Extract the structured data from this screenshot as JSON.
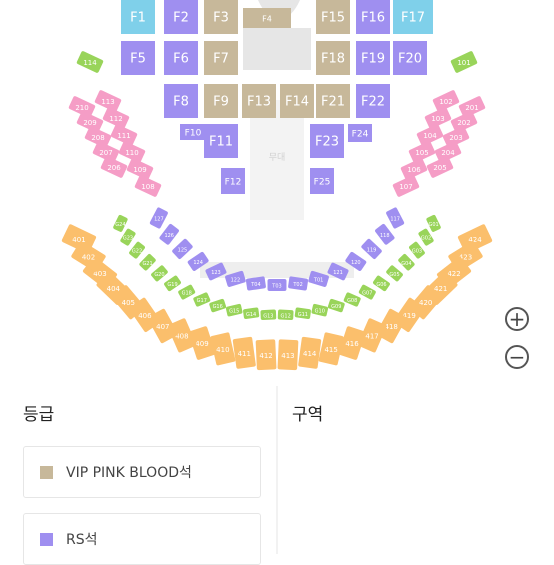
{
  "colors": {
    "vip": "#c7b89a",
    "rs": "#9f8ff0",
    "floor_teal": "#7fd0ea",
    "pink": "#f59dc6",
    "green": "#99d45a",
    "orange": "#fbbf6c",
    "stage": "#e6e6e6"
  },
  "stage_labels": {
    "stage_text": "",
    "center_text": "무대"
  },
  "floor_sections": [
    {
      "label": "F1",
      "grade": "teal"
    },
    {
      "label": "F2",
      "grade": "rs"
    },
    {
      "label": "F3",
      "grade": "vip"
    },
    {
      "label": "F4",
      "grade": "vip"
    },
    {
      "label": "F15",
      "grade": "vip"
    },
    {
      "label": "F16",
      "grade": "rs"
    },
    {
      "label": "F17",
      "grade": "teal"
    },
    {
      "label": "F5",
      "grade": "rs"
    },
    {
      "label": "F6",
      "grade": "rs"
    },
    {
      "label": "F7",
      "grade": "vip"
    },
    {
      "label": "F18",
      "grade": "vip"
    },
    {
      "label": "F19",
      "grade": "rs"
    },
    {
      "label": "F20",
      "grade": "rs"
    },
    {
      "label": "F8",
      "grade": "rs"
    },
    {
      "label": "F9",
      "grade": "vip"
    },
    {
      "label": "F13",
      "grade": "vip"
    },
    {
      "label": "F14",
      "grade": "vip"
    },
    {
      "label": "F21",
      "grade": "vip"
    },
    {
      "label": "F22",
      "grade": "rs"
    },
    {
      "label": "F10",
      "grade": "rs"
    },
    {
      "label": "F11",
      "grade": "rs"
    },
    {
      "label": "F12",
      "grade": "rs"
    },
    {
      "label": "F23",
      "grade": "rs"
    },
    {
      "label": "F24",
      "grade": "rs"
    },
    {
      "label": "F25",
      "grade": "rs"
    }
  ],
  "left_wing": [
    "114",
    "113",
    "112",
    "111",
    "110",
    "109",
    "108",
    "210",
    "209",
    "208",
    "207",
    "206"
  ],
  "right_wing": [
    "101",
    "102",
    "103",
    "104",
    "105",
    "106",
    "107",
    "201",
    "202",
    "203",
    "204",
    "205"
  ],
  "rs_ring": [
    "117",
    "118",
    "119",
    "120",
    "121",
    "T01",
    "T02",
    "T03",
    "T04",
    "122",
    "123",
    "124",
    "125",
    "126",
    "127"
  ],
  "green_ring": [
    "G01",
    "G02",
    "G03",
    "G04",
    "G05",
    "G06",
    "G07",
    "G08",
    "G09",
    "G10",
    "G11",
    "G12",
    "G13",
    "G14",
    "G15",
    "G16",
    "G17",
    "G18",
    "G19",
    "G20",
    "G21",
    "G22",
    "G23",
    "G24"
  ],
  "orange_ring": [
    "424",
    "423",
    "422",
    "421",
    "420",
    "419",
    "418",
    "417",
    "416",
    "415",
    "414",
    "413",
    "412",
    "411",
    "410",
    "409",
    "408",
    "407",
    "406",
    "405",
    "404",
    "403",
    "402",
    "401"
  ],
  "zoom": {
    "in_symbol": "+",
    "out_symbol": "−"
  },
  "grade_panel": {
    "title": "등급",
    "items": [
      {
        "label": "VIP PINK BLOOD석",
        "color": "#c7b89a"
      },
      {
        "label": "RS석",
        "color": "#9f8ff0"
      }
    ]
  },
  "zone_panel": {
    "title": "구역"
  }
}
